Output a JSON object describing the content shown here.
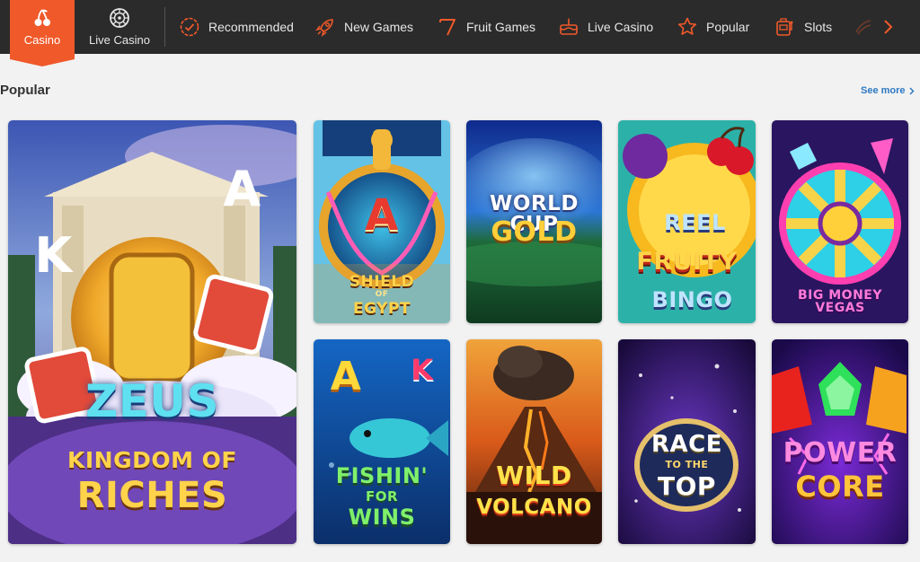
{
  "nav": {
    "primary_tabs": [
      {
        "label": "Casino",
        "icon": "cherries-icon",
        "active": true
      },
      {
        "label": "Live Casino",
        "icon": "roulette-wheel-icon",
        "active": false
      }
    ],
    "categories": [
      {
        "label": "Recommended",
        "icon": "badge-check-icon"
      },
      {
        "label": "New Games",
        "icon": "rocket-icon"
      },
      {
        "label": "Fruit Games",
        "icon": "lucky-seven-icon"
      },
      {
        "label": "Live Casino",
        "icon": "cake-icon"
      },
      {
        "label": "Popular",
        "icon": "star-icon"
      },
      {
        "label": "Slots",
        "icon": "slot-machine-icon"
      }
    ],
    "next_icon": "chevron-right-icon"
  },
  "section": {
    "title": "Popular",
    "see_more": "See more"
  },
  "games": {
    "featured": {
      "title_line1": "ZEUS",
      "title_line2": "KINGDOM OF",
      "title_line3": "RICHES",
      "art_letters": [
        "K",
        "A"
      ]
    },
    "shield": {
      "line1": "SHIELD",
      "line2": "OF",
      "line3": "EGYPT",
      "art_letter": "A"
    },
    "worldcup": {
      "line1": "WORLD CUP",
      "line2": "GOLD"
    },
    "reel": {
      "line1": "REEL",
      "line2": "FRUITY",
      "line3": "BINGO"
    },
    "bigmoney": {
      "line1": "BIG MONEY VEGAS"
    },
    "fishin": {
      "line1": "FISHIN'",
      "line2": "FOR",
      "line3": "WINS",
      "art_letters": [
        "A",
        "K"
      ]
    },
    "volcano": {
      "line1": "WILD",
      "line2": "VOLCANO"
    },
    "race": {
      "line1": "RACE",
      "line2": "TO THE",
      "line3": "TOP"
    },
    "power": {
      "line1": "POWER",
      "line2": "CORE"
    }
  },
  "colors": {
    "accent": "#f0592a",
    "nav_bg": "#2b2b2b",
    "link": "#2d78c2",
    "page_bg": "#f2f2f2"
  }
}
